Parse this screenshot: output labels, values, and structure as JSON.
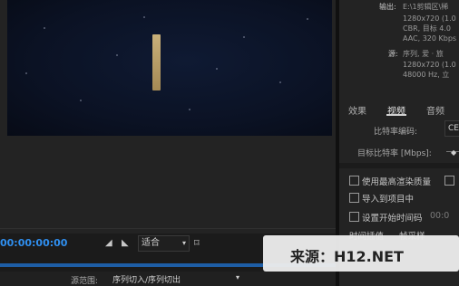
{
  "summary": {
    "output_label": "输出:",
    "output_path": "E:\\1剪辑区\\稀",
    "output_res": "1280x720 (1.0",
    "output_bitrate": "CBR, 目标 4.0",
    "output_audio": "AAC, 320 Kbps",
    "source_label": "源:",
    "source_name": "序列, 爱 · 旅",
    "source_res": "1280x720 (1.0",
    "source_audio": "48000 Hz, 立"
  },
  "tabs": [
    "效果",
    "视频",
    "音频"
  ],
  "video_settings": {
    "bitrate_encoding_label": "比特率编码:",
    "bitrate_encoding_value": "CE",
    "target_bitrate_label": "目标比特率 [Mbps]:"
  },
  "options": [
    {
      "label": "使用最高渲染质量",
      "checked": false
    },
    {
      "label": "导入到项目中",
      "checked": false
    },
    {
      "label": "设置开始时间码",
      "checked": false,
      "extra": "00:0"
    },
    {
      "label": "时间插值",
      "value": "帧采样"
    }
  ],
  "preview": {
    "timecode": "00:00:00:00",
    "fit_value": "适合",
    "range_label": "源范围:",
    "range_value": "序列切入/序列切出",
    "progress": 0.0
  },
  "watermark": "来源：H12.NET",
  "colors": {
    "accent": "#2f8ff0",
    "panel": "#232323",
    "background": "#1b1b1b"
  }
}
